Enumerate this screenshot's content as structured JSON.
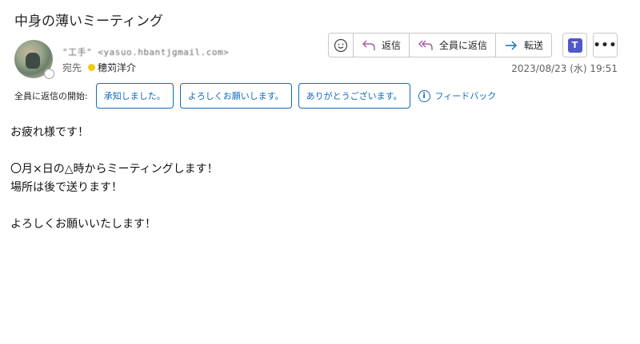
{
  "subject": "中身の薄いミーティング",
  "sender": "\"工手\" <yasuo.hbantjgmail.com>",
  "to_label": "宛先",
  "recipient": "穂苅洋介",
  "actions": {
    "reply": "返信",
    "reply_all": "全員に返信",
    "forward": "転送"
  },
  "date": "2023/08/23 (水) 19:51",
  "quick_reply": {
    "label": "全員に返信の開始:",
    "options": [
      "承知しました。",
      "よろしくお願いします。",
      "ありがとうございます。"
    ],
    "feedback": "フィードバック"
  },
  "body_lines": [
    "お疲れ様です！",
    "",
    "〇月×日の△時からミーティングします！",
    "場所は後で送ります！",
    "",
    "よろしくお願いいたします！"
  ],
  "colors": {
    "accent": "#0f6cbd",
    "reply_icon": "#a55ba6",
    "teams": "#5059c9",
    "presence_away": "#f2c811"
  },
  "icons": {
    "emoji": "smiley-icon",
    "reply": "reply-icon",
    "reply_all": "reply-all-icon",
    "forward": "forward-arrow-icon",
    "teams": "teams-icon",
    "more": "more-icon",
    "info": "info-icon"
  }
}
